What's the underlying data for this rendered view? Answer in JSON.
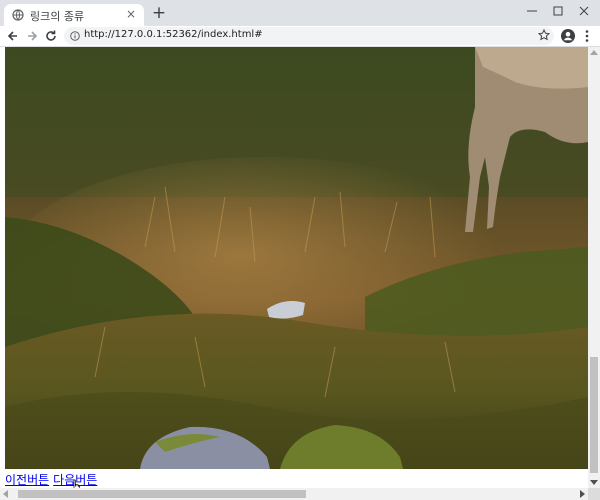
{
  "browser": {
    "tab_title": "링크의 종류",
    "url": "http://127.0.0.1:52362/index.html#",
    "new_tab_symbol": "+",
    "close_tab_symbol": "×"
  },
  "page": {
    "image_description_icon": "photo-grassland-deer",
    "links": [
      {
        "label": "이전버튼"
      },
      {
        "label": "다음버튼"
      }
    ]
  },
  "colors": {
    "titlebar": "#dee1e6",
    "link": "#0000ee",
    "scroll_thumb": "#c1c1c1"
  }
}
